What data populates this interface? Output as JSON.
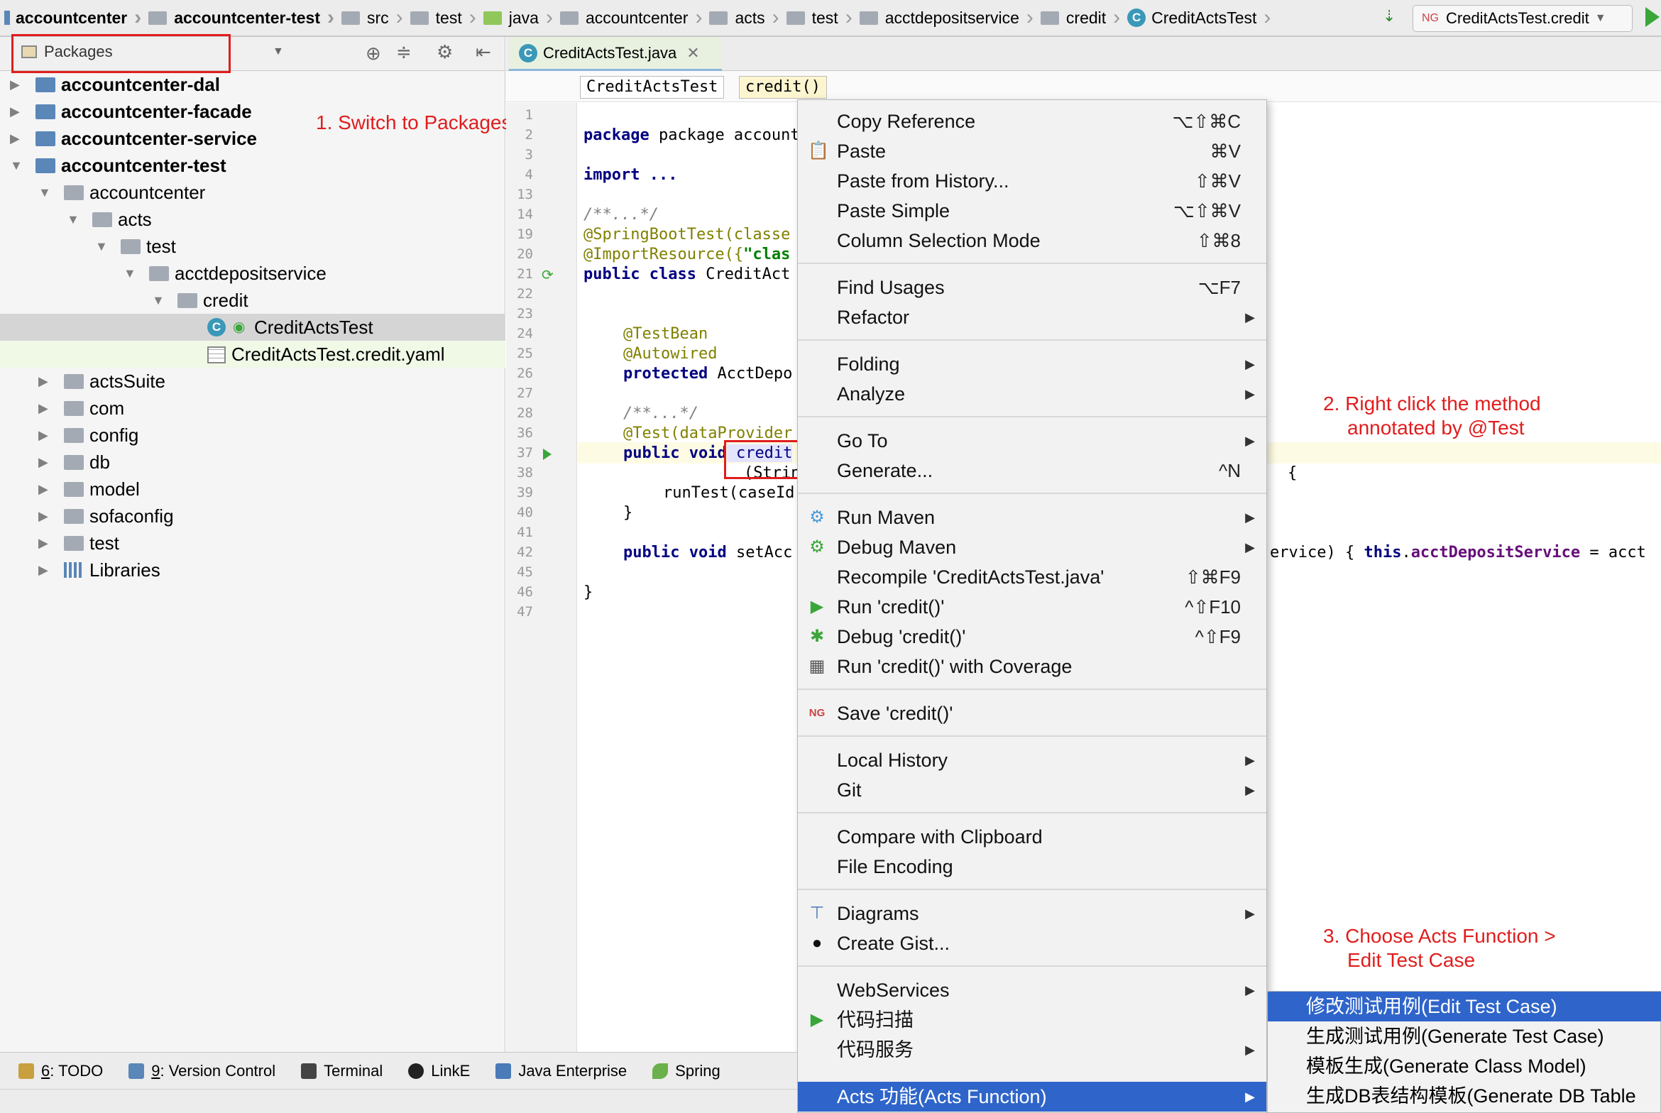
{
  "navbar": {
    "breadcrumbs": [
      "accountcenter",
      "accountcenter-test",
      "src",
      "test",
      "java",
      "accountcenter",
      "acts",
      "test",
      "acctdepositservice",
      "credit",
      "CreditActsTest"
    ],
    "run_config": "CreditActsTest.credit"
  },
  "project_panel": {
    "view_selector": "Packages",
    "tree": [
      {
        "label": "accountcenter-dal",
        "bold": true
      },
      {
        "label": "accountcenter-facade",
        "bold": true
      },
      {
        "label": "accountcenter-service",
        "bold": true
      },
      {
        "label": "accountcenter-test",
        "bold": true
      },
      {
        "label": "accountcenter"
      },
      {
        "label": "acts"
      },
      {
        "label": "test"
      },
      {
        "label": "acctdepositservice"
      },
      {
        "label": "credit"
      },
      {
        "label": "CreditActsTest"
      },
      {
        "label": "CreditActsTest.credit.yaml"
      },
      {
        "label": "actsSuite"
      },
      {
        "label": "com"
      },
      {
        "label": "config"
      },
      {
        "label": "db"
      },
      {
        "label": "model"
      },
      {
        "label": "sofaconfig"
      },
      {
        "label": "test"
      },
      {
        "label": "Libraries"
      }
    ]
  },
  "editor": {
    "tab": "CreditActsTest.java",
    "breadcrumb_class": "CreditActsTest",
    "breadcrumb_method": "credit()",
    "line_numbers": [
      "1",
      "2",
      "3",
      "4",
      "13",
      "14",
      "19",
      "20",
      "21",
      "22",
      "23",
      "24",
      "25",
      "26",
      "27",
      "28",
      "36",
      "37",
      "38",
      "39",
      "40",
      "41",
      "42",
      "45",
      "46",
      "47"
    ],
    "code": {
      "l2": "package accountcenter.",
      "l4": "import ...",
      "l14": "/**...*/",
      "l19": "@SpringBootTest(classe",
      "l20a": "@ImportResource({",
      "l20b": "\"clas",
      "l21a": "public class",
      "l21b": " CreditAct",
      "l24": "@TestBean",
      "l25": "@Autowired",
      "l26a": "protected",
      "l26b": " AcctDepo",
      "l28": "/**...*/",
      "l36": "@Test(dataProvider",
      "l37a": "public void",
      "l37b": " credit",
      "l38": "(Strin",
      "l38b": "{",
      "l39": "runTest(caseId",
      "l40": "}",
      "l42a": "public void",
      "l42b": " setAcc",
      "l42c": "ervice) { ",
      "l42d": "this",
      "l42e": ".",
      "l42f": "acctDepositService",
      "l42g": " = acct",
      "l46": "}"
    }
  },
  "context_menu": {
    "items": [
      {
        "label": "Copy Reference",
        "shortcut": "⌥⇧⌘C"
      },
      {
        "label": "Paste",
        "shortcut": "⌘V"
      },
      {
        "label": "Paste from History...",
        "shortcut": "⇧⌘V"
      },
      {
        "label": "Paste Simple",
        "shortcut": "⌥⇧⌘V"
      },
      {
        "label": "Column Selection Mode",
        "shortcut": "⇧⌘8"
      },
      {
        "label": "Find Usages",
        "shortcut": "⌥F7"
      },
      {
        "label": "Refactor"
      },
      {
        "label": "Folding"
      },
      {
        "label": "Analyze"
      },
      {
        "label": "Go To"
      },
      {
        "label": "Generate...",
        "shortcut": "^N"
      },
      {
        "label": "Run Maven"
      },
      {
        "label": "Debug Maven"
      },
      {
        "label": "Recompile 'CreditActsTest.java'",
        "shortcut": "⇧⌘F9"
      },
      {
        "label": "Run 'credit()'",
        "shortcut": "^⇧F10"
      },
      {
        "label": "Debug 'credit()'",
        "shortcut": "^⇧F9"
      },
      {
        "label": "Run 'credit()' with Coverage"
      },
      {
        "label": "Save 'credit()'"
      },
      {
        "label": "Local History"
      },
      {
        "label": "Git"
      },
      {
        "label": "Compare with Clipboard"
      },
      {
        "label": "File Encoding"
      },
      {
        "label": "Diagrams"
      },
      {
        "label": "Create Gist..."
      },
      {
        "label": "WebServices"
      },
      {
        "label": "代码扫描"
      },
      {
        "label": "代码服务"
      },
      {
        "label": "Acts 功能(Acts Function)"
      }
    ]
  },
  "submenu": {
    "items": [
      "修改测试用例(Edit Test Case)",
      "生成测试用例(Generate Test Case)",
      "模板生成(Generate Class Model)",
      "生成DB表结构模板(Generate DB Table"
    ]
  },
  "bottom_tools": [
    {
      "num": "6",
      "label": ": TODO"
    },
    {
      "num": "9",
      "label": ": Version Control"
    },
    {
      "num": "",
      "label": "Terminal"
    },
    {
      "num": "",
      "label": "LinkE"
    },
    {
      "num": "",
      "label": "Java Enterprise"
    },
    {
      "num": "",
      "label": "Spring"
    }
  ],
  "annotations": {
    "step1": "1. Switch to Packages",
    "step2_line1": "2. Right click the method",
    "step2_line2": "annotated by @Test",
    "step3_line1": "3. Choose Acts Function >",
    "step3_line2": "Edit Test Case"
  },
  "colors": {
    "annotation": "#e01d1d",
    "selection": "#2f65ca",
    "keyword": "#000080",
    "annotation_code": "#808000"
  }
}
